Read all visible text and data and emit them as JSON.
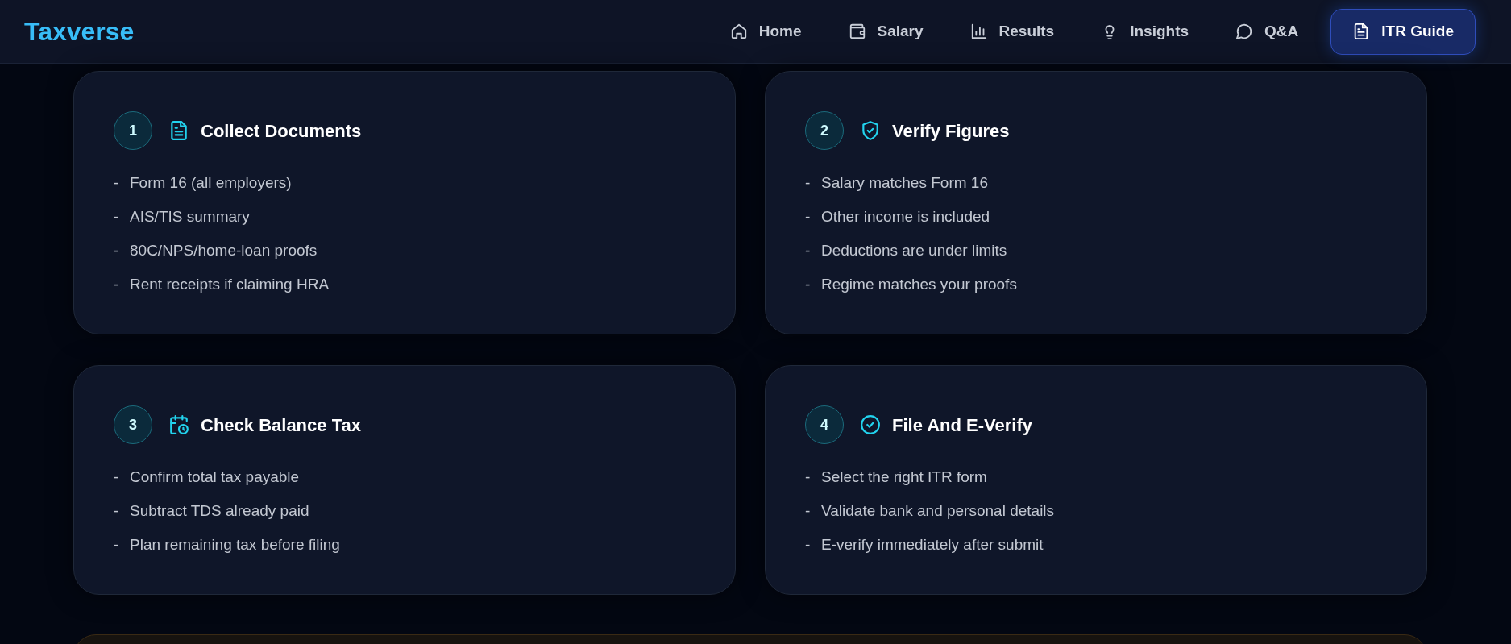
{
  "brand": "Taxverse",
  "nav": [
    {
      "label": "Home",
      "selected": false
    },
    {
      "label": "Salary",
      "selected": false
    },
    {
      "label": "Results",
      "selected": false
    },
    {
      "label": "Insights",
      "selected": false
    },
    {
      "label": "Q&A",
      "selected": false
    },
    {
      "label": "ITR Guide",
      "selected": true
    }
  ],
  "steps": [
    {
      "number": "1",
      "title": "Collect Documents",
      "items": [
        {
          "marker": "-",
          "text": "Form 16 (all employers)"
        },
        {
          "marker": "-",
          "text": "AIS/TIS summary"
        },
        {
          "marker": "-",
          "text": "80C/NPS/home-loan proofs"
        },
        {
          "marker": "-",
          "text": "Rent receipts if claiming HRA"
        }
      ]
    },
    {
      "number": "2",
      "title": "Verify Figures",
      "items": [
        {
          "marker": "-",
          "text": "Salary matches Form 16"
        },
        {
          "marker": "-",
          "text": "Other income is included"
        },
        {
          "marker": "-",
          "text": "Deductions are under limits"
        },
        {
          "marker": "-",
          "text": "Regime matches your proofs"
        }
      ]
    },
    {
      "number": "3",
      "title": "Check Balance Tax",
      "items": [
        {
          "marker": "-",
          "text": "Confirm total tax payable"
        },
        {
          "marker": "-",
          "text": "Subtract TDS already paid"
        },
        {
          "marker": "-",
          "text": "Plan remaining tax before filing"
        }
      ]
    },
    {
      "number": "4",
      "title": "File And E-Verify",
      "items": [
        {
          "marker": "-",
          "text": "Select the right ITR form"
        },
        {
          "marker": "-",
          "text": "Validate bank and personal details"
        },
        {
          "marker": "-",
          "text": "E-verify immediately after submit"
        }
      ]
    }
  ]
}
